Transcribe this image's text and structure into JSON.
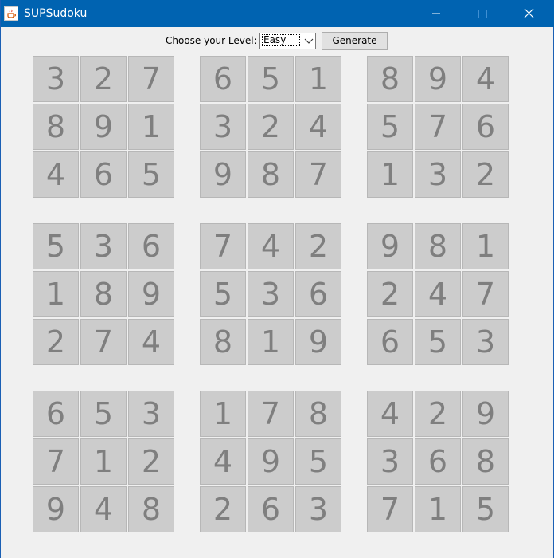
{
  "window": {
    "title": "SUPSudoku",
    "icon": "java-cup-icon",
    "titlebar_color": "#0063b1"
  },
  "controls": {
    "level_label": "Choose your Level:",
    "level_selected": "Easy",
    "generate_label": "Generate"
  },
  "board": [
    [
      3,
      2,
      7,
      6,
      5,
      1,
      8,
      9,
      4
    ],
    [
      8,
      9,
      1,
      3,
      2,
      4,
      5,
      7,
      6
    ],
    [
      4,
      6,
      5,
      9,
      8,
      7,
      1,
      3,
      2
    ],
    [
      5,
      3,
      6,
      7,
      4,
      2,
      9,
      8,
      1
    ],
    [
      1,
      8,
      9,
      5,
      3,
      6,
      2,
      4,
      7
    ],
    [
      2,
      7,
      4,
      8,
      1,
      9,
      6,
      5,
      3
    ],
    [
      6,
      5,
      3,
      1,
      7,
      8,
      4,
      2,
      9
    ],
    [
      7,
      1,
      2,
      4,
      9,
      5,
      3,
      6,
      8
    ],
    [
      9,
      4,
      8,
      2,
      6,
      3,
      7,
      1,
      5
    ]
  ],
  "colors": {
    "cell_background": "#cccccc",
    "cell_digit": "#7f7f7f"
  }
}
